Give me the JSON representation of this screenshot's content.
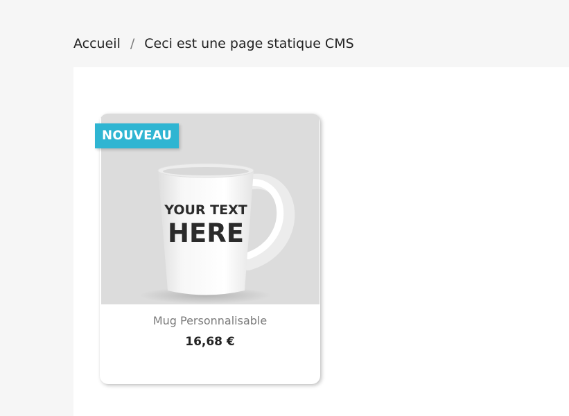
{
  "breadcrumb": {
    "items": [
      "Accueil",
      "Ceci est une page statique CMS"
    ],
    "separator": "/"
  },
  "product": {
    "flag": "NOUVEAU",
    "name": "Mug Personnalisable",
    "price": "16,68 €",
    "image_text_line1": "YOUR TEXT",
    "image_text_line2": "HERE"
  },
  "colors": {
    "accent": "#2fb5d2",
    "background": "#f6f6f6",
    "text": "#232323"
  }
}
